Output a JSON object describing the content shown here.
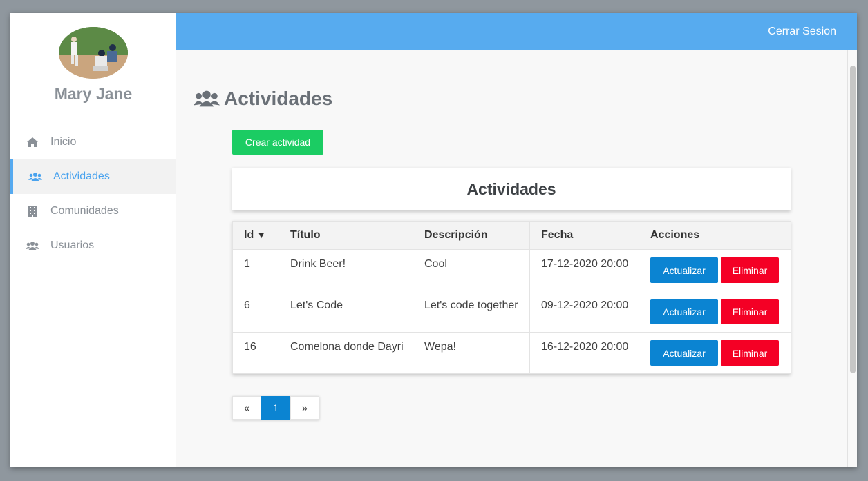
{
  "colors": {
    "topbar": "#57abef",
    "accent": "#4aa3ee",
    "create_button": "#1bcc63",
    "update_button": "#0b84d2",
    "delete_button": "#f40025"
  },
  "sidebar": {
    "user_name": "Mary Jane",
    "avatar_icon": "avatar-photo",
    "items": [
      {
        "label": "Inicio",
        "icon": "home-icon",
        "active": false
      },
      {
        "label": "Actividades",
        "icon": "users-icon",
        "active": true
      },
      {
        "label": "Comunidades",
        "icon": "building-icon",
        "active": false
      },
      {
        "label": "Usuarios",
        "icon": "users-icon",
        "active": false
      }
    ]
  },
  "header": {
    "logout_label": "Cerrar Sesion"
  },
  "main": {
    "title": "Actividades",
    "create_button_label": "Crear actividad",
    "card_title": "Actividades",
    "table": {
      "columns": [
        "Id",
        "Título",
        "Descripción",
        "Fecha",
        "Acciones"
      ],
      "sort_indicator": "▼",
      "rows": [
        {
          "id": "1",
          "titulo": "Drink Beer!",
          "descripcion": "Cool",
          "fecha": "17-12-2020 20:00"
        },
        {
          "id": "6",
          "titulo": "Let's Code",
          "descripcion": "Let's code together",
          "fecha": "09-12-2020 20:00"
        },
        {
          "id": "16",
          "titulo": "Comelona donde Dayri",
          "descripcion": "Wepa!",
          "fecha": "16-12-2020 20:00"
        }
      ],
      "update_label": "Actualizar",
      "delete_label": "Eliminar"
    },
    "pagination": {
      "prev": "«",
      "current": "1",
      "next": "»"
    }
  }
}
